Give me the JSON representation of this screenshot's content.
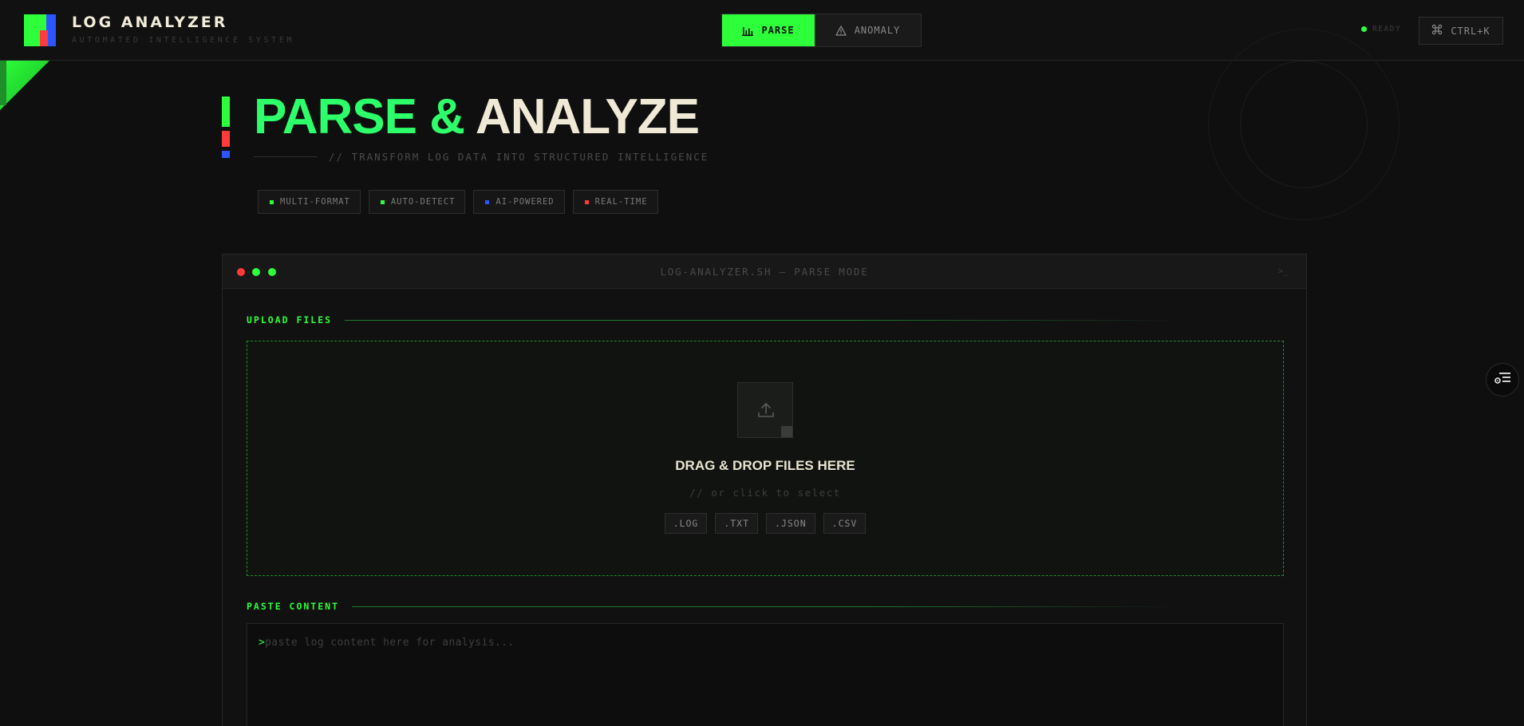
{
  "app": {
    "title": "LOG ANALYZER",
    "subtitle": "AUTOMATED INTELLIGENCE SYSTEM"
  },
  "mode_tabs": [
    {
      "label": "PARSE",
      "icon": "bar-chart-icon",
      "active": true
    },
    {
      "label": "ANOMALY",
      "icon": "warning-icon",
      "active": false
    }
  ],
  "status": {
    "label": "READY"
  },
  "command_button": {
    "label": "CTRL+K",
    "icon": "command-icon"
  },
  "hero": {
    "title_part1": "PARSE &",
    "title_part2": "ANALYZE",
    "subtitle": "// TRANSFORM LOG DATA INTO STRUCTURED INTELLIGENCE"
  },
  "features": [
    {
      "label": "MULTI-FORMAT",
      "color": "#2dff3a"
    },
    {
      "label": "AUTO-DETECT",
      "color": "#2dff3a"
    },
    {
      "label": "AI-POWERED",
      "color": "#2b55ff"
    },
    {
      "label": "REAL-TIME",
      "color": "#ff3b3b"
    }
  ],
  "window": {
    "title": "LOG-ANALYZER.SH — PARSE MODE",
    "prompt_glyph": ">_"
  },
  "upload": {
    "section_label": "UPLOAD FILES",
    "title": "DRAG & DROP FILES HERE",
    "subtitle": "// or click to select",
    "extensions": [
      ".LOG",
      ".TXT",
      ".JSON",
      ".CSV"
    ]
  },
  "paste": {
    "section_label": "PASTE CONTENT",
    "caret": ">",
    "placeholder": "paste log content here for analysis..."
  },
  "colors": {
    "accent_green": "#2dff3a",
    "accent_blue": "#2b55ff",
    "accent_red": "#ff3b3b",
    "cream": "#efe9d6"
  }
}
